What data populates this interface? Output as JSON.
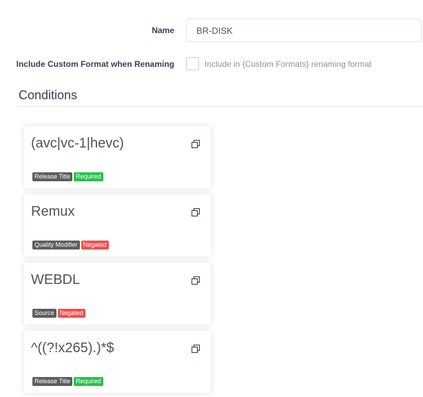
{
  "form": {
    "name_label": "Name",
    "name_value": "BR-DISK",
    "include_label": "Include Custom Format when Renaming",
    "include_checked": false,
    "include_help": "Include in {Custom Formats} renaming format"
  },
  "conditions": {
    "title": "Conditions",
    "cards": [
      {
        "title": "(avc|vc-1|hevc)",
        "type_tag": "Release Title",
        "status_tag": "Required",
        "status_color": "#27c24c"
      },
      {
        "title": "Remux",
        "type_tag": "Quality Modifier",
        "status_tag": "Negated",
        "status_color": "#f05050"
      },
      {
        "title": "WEBDL",
        "type_tag": "Source",
        "status_tag": "Negated",
        "status_color": "#f05050"
      },
      {
        "title": "^((?!x265).)*$",
        "type_tag": "Release Title",
        "status_tag": "Required",
        "status_color": "#27c24c"
      }
    ]
  },
  "icons": {
    "clone": "clone-icon"
  },
  "colors": {
    "tag_default": "#5d5d5d",
    "tag_success": "#27c24c",
    "tag_danger": "#f05050"
  }
}
